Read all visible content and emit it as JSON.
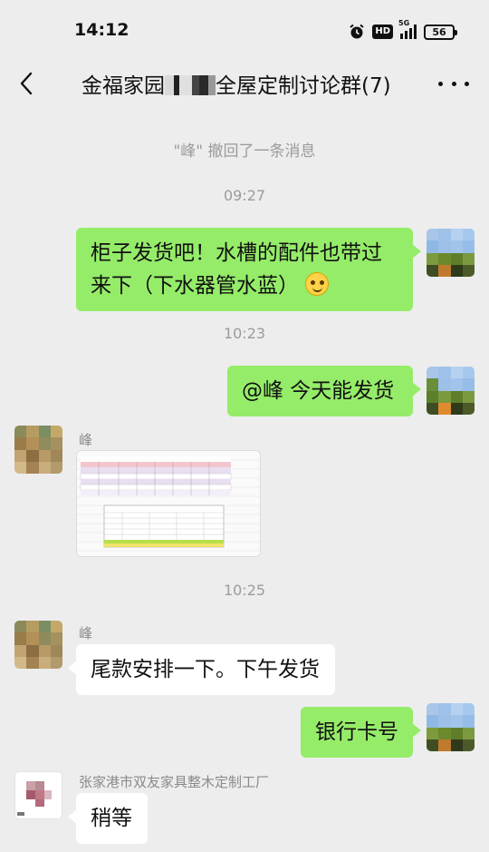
{
  "status_bar": {
    "time": "14:12",
    "icons": [
      "alarm-icon",
      "hd-icon",
      "signal-5g-icon",
      "battery-icon"
    ],
    "hd_label": "HD",
    "network_label": "5G",
    "battery_level": "56"
  },
  "header": {
    "back_icon": "chevron-left-icon",
    "title_prefix": "金福家园",
    "title_suffix": "全屋定制讨论群(7)",
    "more_icon": "more-dots-icon"
  },
  "messages": {
    "recall_notice": "\"峰\" 撤回了一条消息",
    "time_1": "09:27",
    "msg_1": "柜子发货吧！水槽的配件也带过来下（下水器管水蓝）",
    "time_2": "10:23",
    "msg_2": "@峰  今天能发货",
    "sender_1": "峰",
    "time_3": "10:25",
    "sender_2": "峰",
    "msg_3": "尾款安排一下。下午发货",
    "msg_4": "银行卡号",
    "sender_3": "张家港市双友家具整木定制工厂",
    "msg_5": "稍等"
  },
  "colors": {
    "background": "#ededed",
    "my_bubble": "#95ec69",
    "other_bubble": "#ffffff",
    "meta_text": "#9b9b9b"
  }
}
